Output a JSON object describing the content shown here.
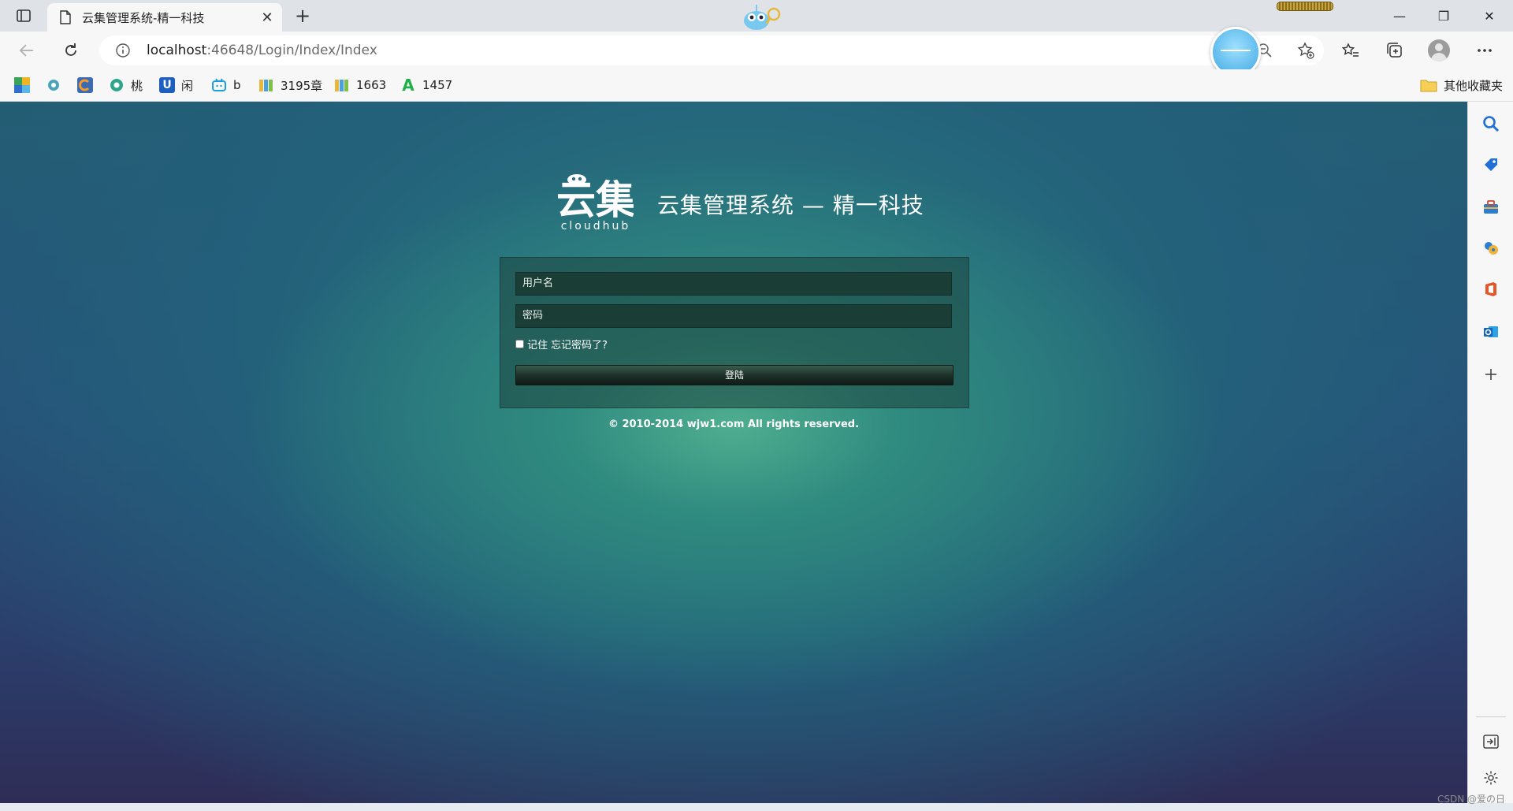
{
  "browser": {
    "tab": {
      "title": "云集管理系统-精一科技",
      "close": "✕"
    },
    "new_tab": "+",
    "window": {
      "minimize": "—",
      "restore": "❐",
      "close": "✕"
    },
    "address": {
      "host": "localhost",
      "path": ":46648/Login/Index/Index"
    },
    "favorites": [
      {
        "icon": "tiles-icon",
        "label": ""
      },
      {
        "icon": "gear-flower-icon",
        "label": ""
      },
      {
        "icon": "orange-c-icon",
        "label": ""
      },
      {
        "icon": "peach-site-icon",
        "label": "桃"
      },
      {
        "icon": "u-icon",
        "label": "闲"
      },
      {
        "icon": "bilibili-icon",
        "label": "b"
      },
      {
        "icon": "book-icon",
        "label": "3195章"
      },
      {
        "icon": "book-icon",
        "label": "1663"
      },
      {
        "icon": "a-icon",
        "label": "1457"
      }
    ],
    "other_favorites": "其他收藏夹"
  },
  "page": {
    "logo_text": "云集",
    "logo_sub": "cloudhub",
    "title": "云集管理系统 — 精一科技",
    "username_placeholder": "用户名",
    "password_placeholder": "密码",
    "remember_label": "记住",
    "forgot_link": "忘记密码了?",
    "login_button": "登陆",
    "copyright": "© 2010-2014 wjw1.com All rights reserved."
  },
  "watermark": "CSDN @爱の日",
  "colors": {
    "page_gradient_center": "#4fae8f",
    "page_gradient_edge": "#2e2d57",
    "login_button": "#1b2e27",
    "browser_chrome": "#f7f7f7"
  }
}
